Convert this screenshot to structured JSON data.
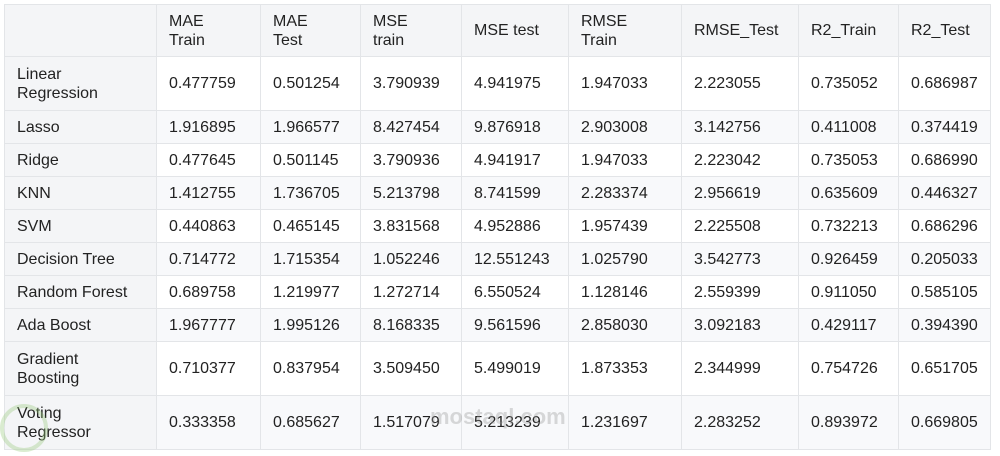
{
  "table": {
    "columns": [
      "",
      "MAE Train",
      "MAE Test",
      "MSE train",
      "MSE test",
      "RMSE Train",
      "RMSE_Test",
      "R2_Train",
      "R2_Test"
    ],
    "rows": [
      {
        "model": "Linear Regression",
        "values": [
          "0.477759",
          "0.501254",
          "3.790939",
          "4.941975",
          "1.947033",
          "2.223055",
          "0.735052",
          "0.686987"
        ]
      },
      {
        "model": "Lasso",
        "values": [
          "1.916895",
          "1.966577",
          "8.427454",
          "9.876918",
          "2.903008",
          "3.142756",
          "0.411008",
          "0.374419"
        ]
      },
      {
        "model": "Ridge",
        "values": [
          "0.477645",
          "0.501145",
          "3.790936",
          "4.941917",
          "1.947033",
          "2.223042",
          "0.735053",
          "0.686990"
        ]
      },
      {
        "model": "KNN",
        "values": [
          "1.412755",
          "1.736705",
          "5.213798",
          "8.741599",
          "2.283374",
          "2.956619",
          "0.635609",
          "0.446327"
        ]
      },
      {
        "model": "SVM",
        "values": [
          "0.440863",
          "0.465145",
          "3.831568",
          "4.952886",
          "1.957439",
          "2.225508",
          "0.732213",
          "0.686296"
        ]
      },
      {
        "model": "Decision Tree",
        "values": [
          "0.714772",
          "1.715354",
          "1.052246",
          "12.551243",
          "1.025790",
          "3.542773",
          "0.926459",
          "0.205033"
        ]
      },
      {
        "model": "Random Forest",
        "values": [
          "0.689758",
          "1.219977",
          "1.272714",
          "6.550524",
          "1.128146",
          "2.559399",
          "0.911050",
          "0.585105"
        ]
      },
      {
        "model": "Ada Boost",
        "values": [
          "1.967777",
          "1.995126",
          "8.168335",
          "9.561596",
          "2.858030",
          "3.092183",
          "0.429117",
          "0.394390"
        ]
      },
      {
        "model": "Gradient Boosting",
        "values": [
          "0.710377",
          "0.837954",
          "3.509450",
          "5.499019",
          "1.873353",
          "2.344999",
          "0.754726",
          "0.651705"
        ]
      },
      {
        "model": "Voting Regressor",
        "values": [
          "0.333358",
          "0.685627",
          "1.517079",
          "5.213239",
          "1.231697",
          "2.283252",
          "0.893972",
          "0.669805"
        ]
      }
    ]
  },
  "watermark": "mostaql.com"
}
